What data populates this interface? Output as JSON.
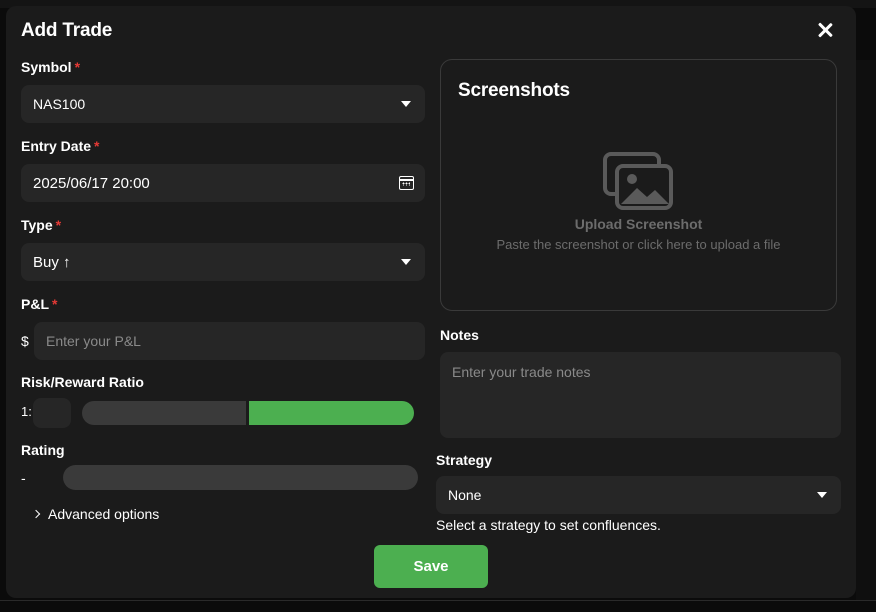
{
  "modal": {
    "title": "Add Trade",
    "close_icon": "close-icon"
  },
  "form": {
    "required_mark": "*",
    "symbol": {
      "label": "Symbol",
      "value": "NAS100"
    },
    "entry_date": {
      "label": "Entry Date",
      "value": "2025/06/17 20:00",
      "icon": "calendar-icon"
    },
    "type": {
      "label": "Type",
      "value": "Buy ↑"
    },
    "pnl": {
      "label": "P&L",
      "prefix": "$",
      "placeholder": "Enter your P&L",
      "value": ""
    },
    "risk_reward": {
      "label": "Risk/Reward Ratio",
      "prefix": "1:",
      "value": ""
    },
    "rating": {
      "label": "Rating",
      "value": "-"
    },
    "advanced": {
      "label": "Advanced options"
    }
  },
  "screenshots": {
    "title": "Screenshots",
    "icon": "image-gallery-icon",
    "upload_title": "Upload Screenshot",
    "upload_subtitle": "Paste the screenshot or click here to upload a file"
  },
  "notes": {
    "label": "Notes",
    "placeholder": "Enter your trade notes",
    "value": ""
  },
  "strategy": {
    "label": "Strategy",
    "value": "None",
    "helper": "Select a strategy to set confluences."
  },
  "actions": {
    "save": "Save"
  },
  "colors": {
    "accent_green": "#4caf50",
    "required_red": "#e53935",
    "modal_bg": "#1b1b1b",
    "field_bg": "#262626"
  }
}
